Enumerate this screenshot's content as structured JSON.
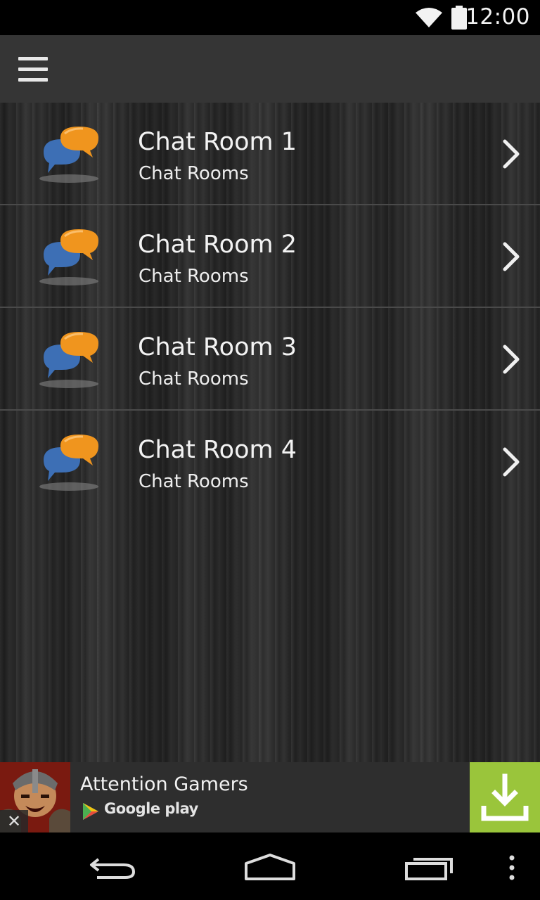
{
  "status_bar": {
    "time": "12:00",
    "icons": [
      "wifi-icon",
      "battery-icon"
    ]
  },
  "action_bar": {
    "menu_icon": "hamburger-menu-icon"
  },
  "rooms": [
    {
      "title": "Chat Room 1",
      "subtitle": "Chat Rooms",
      "icon": "chat-bubbles-icon"
    },
    {
      "title": "Chat Room 2",
      "subtitle": "Chat Rooms",
      "icon": "chat-bubbles-icon"
    },
    {
      "title": "Chat Room 3",
      "subtitle": "Chat Rooms",
      "icon": "chat-bubbles-icon"
    },
    {
      "title": "Chat Room 4",
      "subtitle": "Chat Rooms",
      "icon": "chat-bubbles-icon"
    }
  ],
  "ad": {
    "title": "Attention Gamers",
    "store": "Google play",
    "close_glyph": "✕",
    "download_color": "#9ac53b"
  },
  "nav_bar": {
    "icons": [
      "back-icon",
      "home-icon",
      "recents-icon",
      "overflow-menu-icon"
    ]
  },
  "colors": {
    "bubble_orange": "#f0951e",
    "bubble_blue": "#3d6fb5",
    "action_bar": "#353535"
  }
}
